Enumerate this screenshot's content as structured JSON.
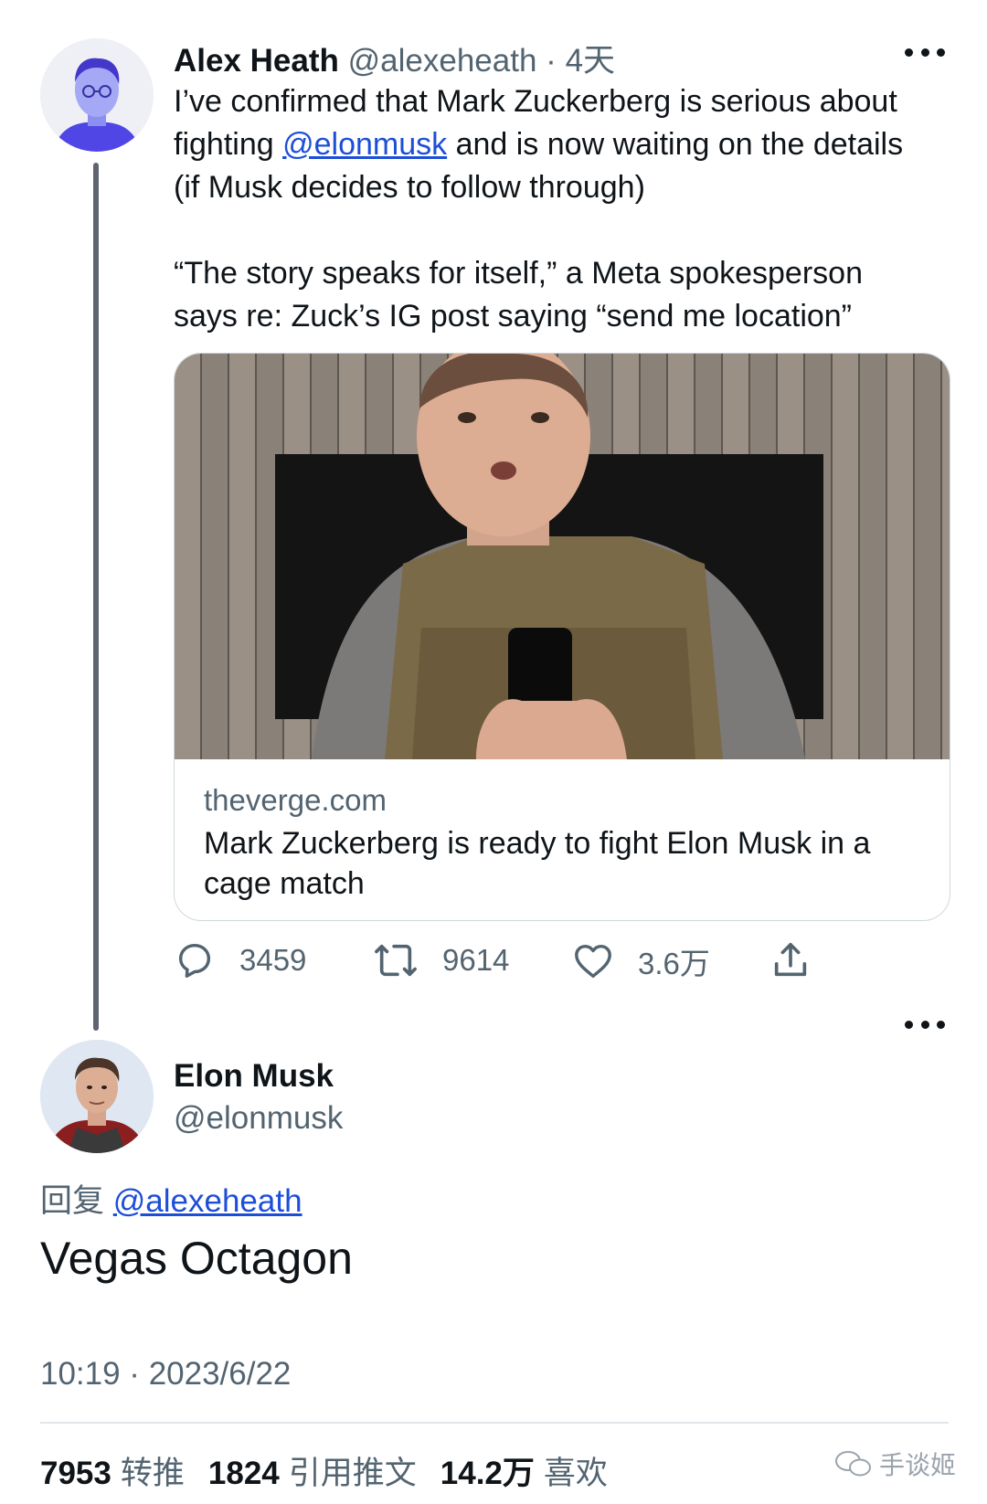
{
  "tweet1": {
    "name": "Alex Heath",
    "handle": "@alexeheath",
    "separator": "·",
    "age": "4天",
    "line1": "I’ve confirmed that Mark Zuckerberg is serious about",
    "line2_pre": "fighting ",
    "mention": "@elonmusk",
    "line2_post": " and is now waiting on the details",
    "line3": "(if Musk decides to follow through)",
    "line4": "“The story speaks for itself,” a Meta spokesperson",
    "line5": "says re: Zuck’s IG post saying “send me location”",
    "card": {
      "domain": "theverge.com",
      "title": "Mark Zuckerberg is ready to fight Elon Musk in a cage match"
    },
    "actions": {
      "replies": "3459",
      "retweets": "9614",
      "likes": "3.6万"
    }
  },
  "tweet2": {
    "name": "Elon Musk",
    "handle": "@elonmusk",
    "reply_label": "回复",
    "reply_mention": "@alexeheath",
    "text": "Vegas Octagon",
    "timestamp": "10:19 · 2023/6/22",
    "stats": {
      "retweets_count": "7953",
      "retweets_label": "转推",
      "quotes_count": "1824",
      "quotes_label": "引用推文",
      "likes_count": "14.2万",
      "likes_label": "喜欢"
    }
  },
  "watermark": "手谈姬",
  "colors": {
    "link": "#1d4ed8",
    "secondary_text": "#536471",
    "thread_line": "#5f6470",
    "border": "#cfd9de"
  }
}
